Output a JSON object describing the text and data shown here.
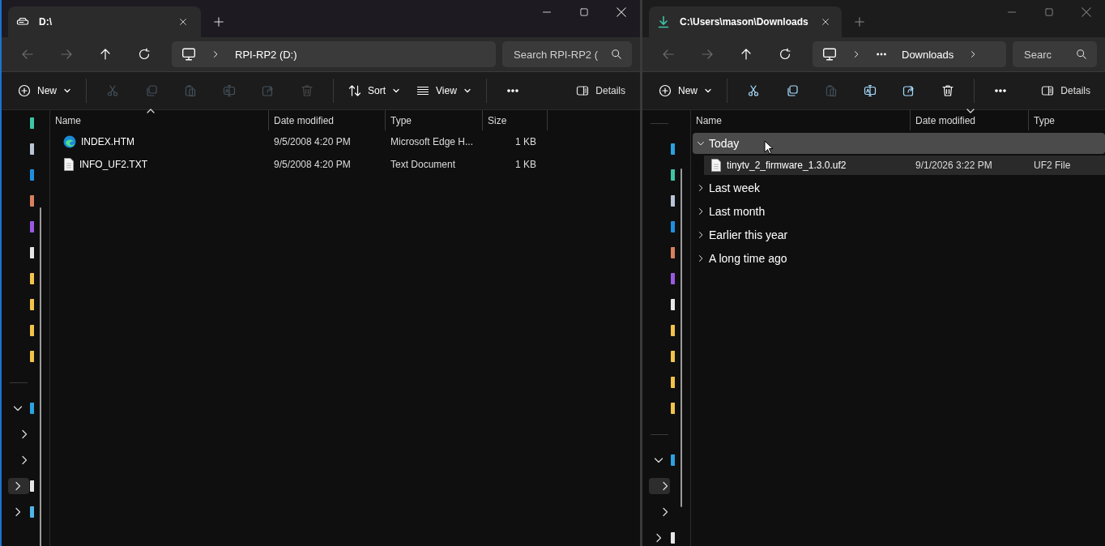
{
  "windows": [
    {
      "active": true,
      "tab": {
        "title": "D:\\",
        "kind": "drive"
      },
      "address": {
        "overflow": false,
        "crumbs": [
          "RPI-RP2 (D:)"
        ],
        "trailing_chevron": false
      },
      "search": {
        "placeholder": "Search RPI-RP2 ("
      },
      "toolbar": [
        {
          "kind": "new",
          "label": "New",
          "disabled": false
        },
        {
          "kind": "separator"
        },
        {
          "kind": "cut",
          "disabled": true
        },
        {
          "kind": "copy",
          "disabled": true
        },
        {
          "kind": "paste",
          "disabled": true
        },
        {
          "kind": "rename",
          "disabled": true
        },
        {
          "kind": "share",
          "disabled": true
        },
        {
          "kind": "delete",
          "disabled": true
        },
        {
          "kind": "separator"
        },
        {
          "kind": "sort",
          "label": "Sort",
          "disabled": false
        },
        {
          "kind": "view",
          "label": "View",
          "disabled": false
        },
        {
          "kind": "separator"
        },
        {
          "kind": "more",
          "disabled": false
        }
      ],
      "details": {
        "label": "Details"
      },
      "nav": [
        {
          "kind": "pin",
          "color": "#3fc4a4"
        },
        {
          "kind": "pin",
          "color": "#b9c4d6"
        },
        {
          "kind": "pin",
          "color": "#1e8fe0"
        },
        {
          "kind": "pin",
          "color": "#d9805f"
        },
        {
          "kind": "pin",
          "color": "#9b59e0"
        },
        {
          "kind": "pin",
          "color": "#e6e6e6"
        },
        {
          "kind": "pin",
          "color": "#f2c34b"
        },
        {
          "kind": "pin",
          "color": "#f2c34b"
        },
        {
          "kind": "pin",
          "color": "#f2c34b"
        },
        {
          "kind": "pin",
          "color": "#f2c34b"
        },
        {
          "kind": "divider"
        },
        {
          "kind": "tree",
          "expanded": true,
          "selected": false,
          "color": "#2aa3e0",
          "children": [
            {
              "kind": "tree",
              "expanded": false,
              "selected": false
            },
            {
              "kind": "tree",
              "expanded": false,
              "selected": false
            }
          ]
        },
        {
          "kind": "tree",
          "expanded": false,
          "selected": true,
          "color": "#e6e6e6"
        },
        {
          "kind": "tree",
          "expanded": false,
          "selected": false,
          "color": "#4fb6e8"
        }
      ],
      "columns": [
        {
          "label": "Name",
          "kind": "ascending"
        },
        {
          "label": "Date modified",
          "kind": "plain"
        },
        {
          "label": "Type",
          "kind": "plain"
        },
        {
          "label": "Size",
          "kind": "plain"
        }
      ],
      "files": [
        {
          "kind": "edge",
          "name": "INDEX.HTM",
          "date": "9/5/2008 4:20 PM",
          "type": "Microsoft Edge H...",
          "size": "1 KB",
          "selected": false
        },
        {
          "kind": "document",
          "name": "INFO_UF2.TXT",
          "date": "9/5/2008 4:20 PM",
          "type": "Text Document",
          "size": "1 KB",
          "selected": false
        }
      ]
    },
    {
      "active": false,
      "tab": {
        "title": "C:\\Users\\mason\\Downloads",
        "kind": "download"
      },
      "address": {
        "overflow": true,
        "crumbs": [
          "Downloads"
        ],
        "trailing_chevron": true
      },
      "search": {
        "placeholder": "Searc"
      },
      "toolbar": [
        {
          "kind": "new",
          "label": "New",
          "disabled": false
        },
        {
          "kind": "separator"
        },
        {
          "kind": "cut",
          "disabled": false
        },
        {
          "kind": "copy",
          "disabled": false
        },
        {
          "kind": "paste",
          "disabled": true
        },
        {
          "kind": "rename",
          "disabled": false
        },
        {
          "kind": "share",
          "disabled": false
        },
        {
          "kind": "delete",
          "disabled": false
        },
        {
          "kind": "separator"
        },
        {
          "kind": "more",
          "disabled": false
        }
      ],
      "details": {
        "label": "Details"
      },
      "nav": [
        {
          "kind": "divider"
        },
        {
          "kind": "pin",
          "color": "#2aa3e0"
        },
        {
          "kind": "pin",
          "color": "#3fc4a4"
        },
        {
          "kind": "pin",
          "color": "#b9c4d6"
        },
        {
          "kind": "pin",
          "color": "#1e8fe0"
        },
        {
          "kind": "pin",
          "color": "#d9805f"
        },
        {
          "kind": "pin",
          "color": "#9b59e0"
        },
        {
          "kind": "pin",
          "color": "#e6e6e6"
        },
        {
          "kind": "pin",
          "color": "#f2c34b"
        },
        {
          "kind": "pin",
          "color": "#f2c34b"
        },
        {
          "kind": "pin",
          "color": "#f2c34b"
        },
        {
          "kind": "pin",
          "color": "#f2c34b"
        },
        {
          "kind": "divider"
        },
        {
          "kind": "tree",
          "expanded": true,
          "selected": false,
          "color": "#2aa3e0",
          "children": [
            {
              "kind": "tree",
              "expanded": false,
              "selected": true
            },
            {
              "kind": "tree",
              "expanded": false,
              "selected": false
            }
          ]
        },
        {
          "kind": "tree",
          "expanded": false,
          "selected": false,
          "color": "#e6e6e6"
        }
      ],
      "columns": [
        {
          "label": "Name",
          "kind": "plain"
        },
        {
          "label": "Date modified",
          "kind": "descending"
        },
        {
          "label": "Type",
          "kind": "plain"
        }
      ],
      "groups": [
        {
          "label": "Today",
          "expanded": true,
          "hovered": true,
          "files": [
            {
              "kind": "document",
              "name": "tinytv_2_firmware_1.3.0.uf2",
              "date": "9/1/2026 3:22 PM",
              "type": "UF2 File",
              "selected": true
            }
          ]
        },
        {
          "label": "Last week",
          "expanded": false,
          "hovered": false
        },
        {
          "label": "Last month",
          "expanded": false,
          "hovered": false
        },
        {
          "label": "Earlier this year",
          "expanded": false,
          "hovered": false
        },
        {
          "label": "A long time ago",
          "expanded": false,
          "hovered": false
        }
      ]
    }
  ]
}
